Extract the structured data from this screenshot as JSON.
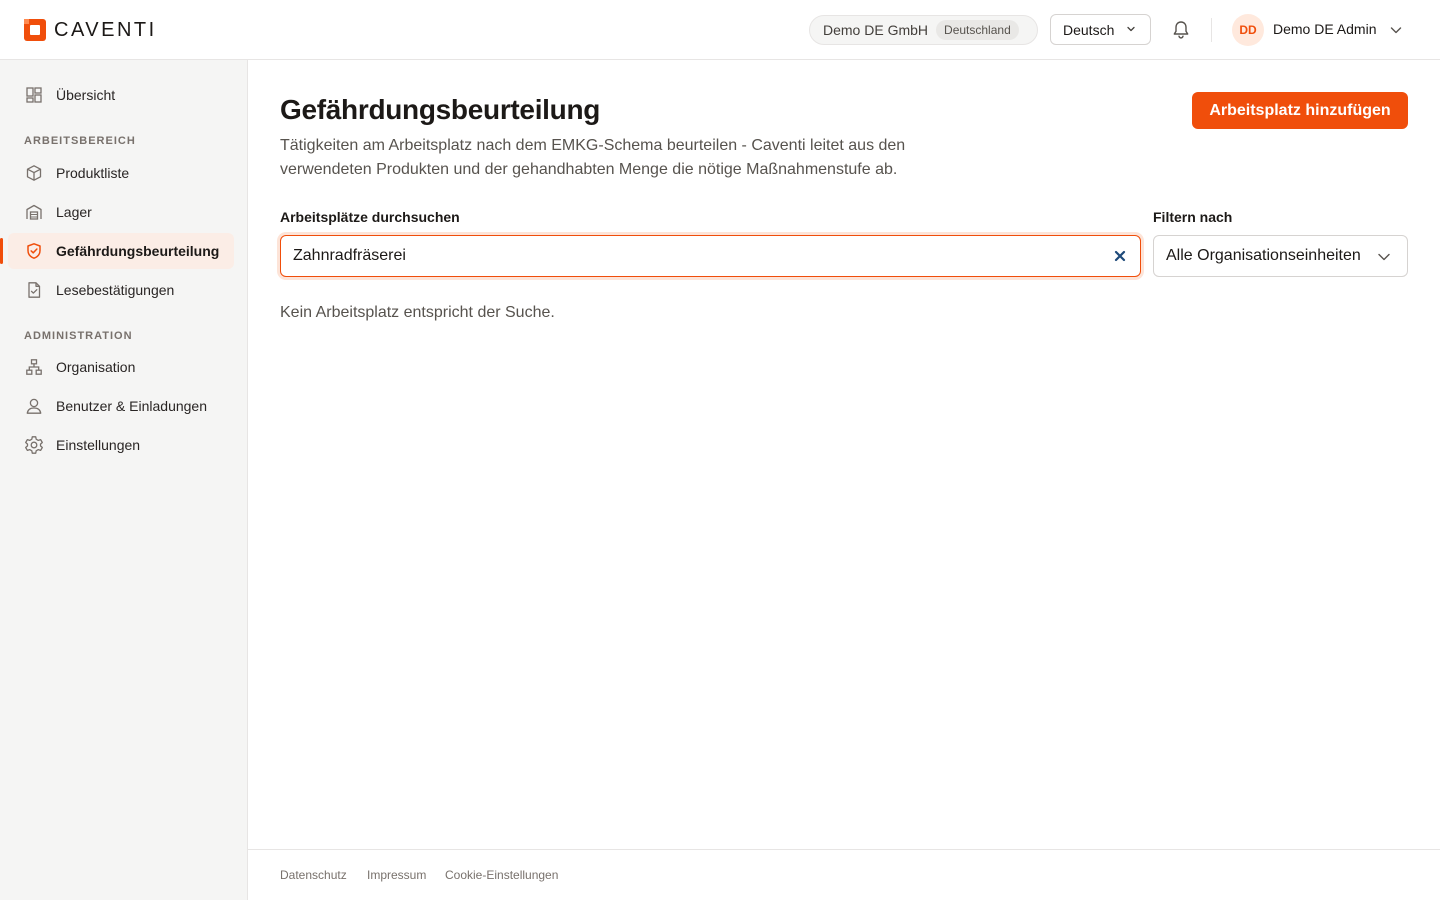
{
  "brand": {
    "name": "CAVENTI",
    "accent": "#f04e0b"
  },
  "header": {
    "org_name": "Demo DE GmbH",
    "org_country": "Deutschland",
    "language": "Deutsch",
    "user_initials": "DD",
    "user_name": "Demo DE Admin",
    "notification_icon": "bell-icon"
  },
  "sidebar": {
    "overview": "Übersicht",
    "section_work": "ARBEITSBEREICH",
    "work_items": [
      {
        "label": "Produktliste",
        "icon": "box-icon"
      },
      {
        "label": "Lager",
        "icon": "warehouse-icon"
      },
      {
        "label": "Gefährdungsbeurteilung",
        "icon": "shield-check-icon",
        "active": true
      },
      {
        "label": "Lesebestätigungen",
        "icon": "document-check-icon"
      }
    ],
    "section_admin": "ADMINISTRATION",
    "admin_items": [
      {
        "label": "Organisation",
        "icon": "org-tree-icon"
      },
      {
        "label": "Benutzer & Einladungen",
        "icon": "user-icon"
      },
      {
        "label": "Einstellungen",
        "icon": "gear-icon"
      }
    ]
  },
  "main": {
    "title": "Gefährdungsbeurteilung",
    "description": "Tätigkeiten am Arbeitsplatz nach dem EMKG-Schema beurteilen - Caventi leitet aus den verwendeten Produkten und der gehandhabten Menge die nötige Maßnahmenstufe ab.",
    "add_button": "Arbeitsplatz hinzufügen",
    "search_label": "Arbeitsplätze durchsuchen",
    "search_value": "Zahnradfräserei",
    "filter_label": "Filtern nach",
    "filter_value": "Alle Organisationseinheiten",
    "empty_message": "Kein Arbeitsplatz entspricht der Suche."
  },
  "footer": {
    "links": [
      "Datenschutz",
      "Impressum",
      "Cookie-Einstellungen"
    ]
  }
}
